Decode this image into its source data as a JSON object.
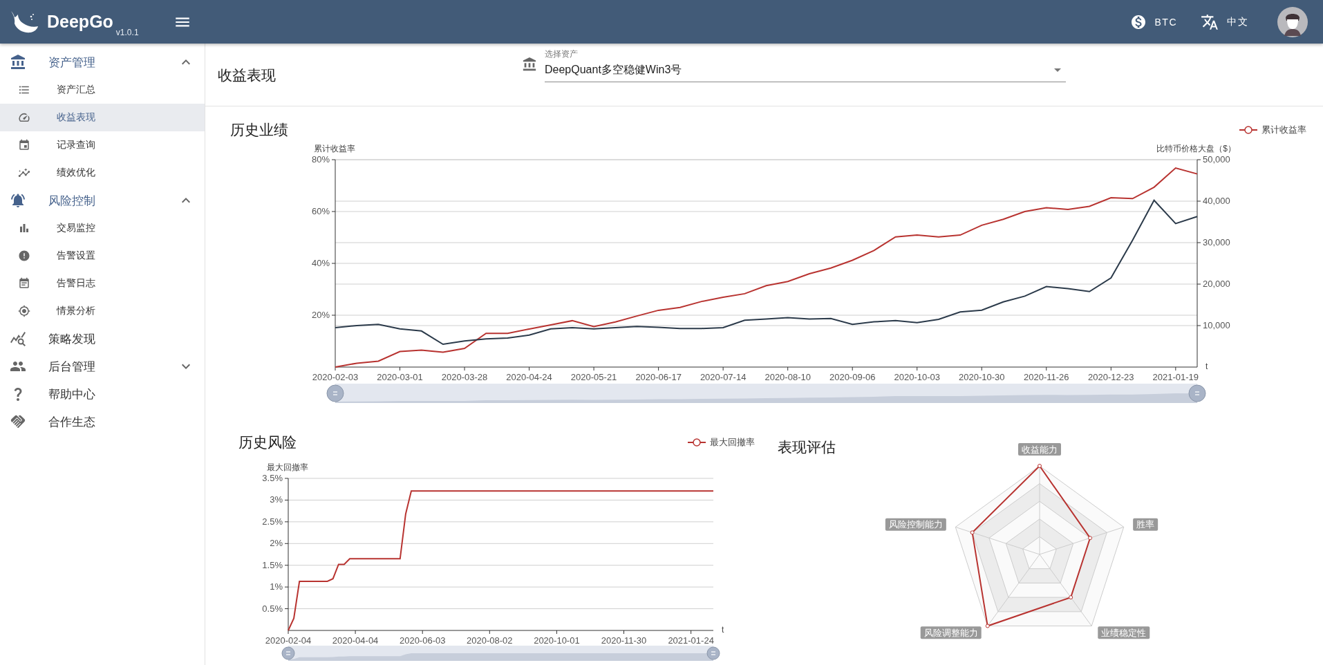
{
  "header": {
    "logo": "DeepGo",
    "version": "v1.0.1",
    "currency": "BTC",
    "language": "中文"
  },
  "sidebar": {
    "items": [
      {
        "label": "资产管理",
        "expanded": true,
        "children": [
          {
            "label": "资产汇总",
            "selected": false
          },
          {
            "label": "收益表现",
            "selected": true
          },
          {
            "label": "记录查询",
            "selected": false
          },
          {
            "label": "绩效优化",
            "selected": false
          }
        ]
      },
      {
        "label": "风险控制",
        "expanded": true,
        "children": [
          {
            "label": "交易监控",
            "selected": false
          },
          {
            "label": "告警设置",
            "selected": false
          },
          {
            "label": "告警日志",
            "selected": false
          },
          {
            "label": "情景分析",
            "selected": false
          }
        ]
      },
      {
        "label": "策略发现"
      },
      {
        "label": "后台管理",
        "expanded": false
      },
      {
        "label": "帮助中心"
      },
      {
        "label": "合作生态"
      }
    ]
  },
  "page": {
    "title": "收益表现",
    "asset_select": {
      "label": "选择资产",
      "value": "DeepQuant多空稳健Win3号"
    }
  },
  "history": {
    "title": "历史业绩",
    "chart_data": {
      "type": "line",
      "grid": true,
      "ylabel": "累计收益率",
      "y2label": "比特币价格大盘（$）",
      "xlabel": "t",
      "ylim": [
        0,
        80
      ],
      "y2lim": [
        0,
        50000
      ],
      "categories": [
        "2020-02-03",
        null,
        null,
        "2020-03-01",
        null,
        null,
        "2020-03-28",
        null,
        null,
        "2020-04-24",
        null,
        null,
        "2020-05-21",
        null,
        null,
        "2020-06-17",
        null,
        null,
        "2020-07-14",
        null,
        null,
        "2020-08-10",
        null,
        null,
        "2020-09-06",
        null,
        null,
        "2020-10-03",
        null,
        null,
        "2020-10-30",
        null,
        null,
        "2020-11-26",
        null,
        null,
        "2020-12-23",
        null,
        null,
        "2021-01-19",
        null
      ],
      "yticks": [
        {
          "value": 20,
          "label": "20%"
        },
        {
          "value": 40,
          "label": "40%"
        },
        {
          "value": 60,
          "label": "60%"
        },
        {
          "value": 80,
          "label": "80%"
        }
      ],
      "y2ticks": [
        {
          "value": 10000,
          "label": "10,000"
        },
        {
          "value": 20000,
          "label": "20,000"
        },
        {
          "value": 30000,
          "label": "30,000"
        },
        {
          "value": 40000,
          "label": "40,000"
        },
        {
          "value": 50000,
          "label": "50,000"
        }
      ],
      "series": [
        {
          "name": "累计收益率",
          "color": "#b83330",
          "values": [
            0,
            1.5,
            2.3,
            6,
            6.5,
            5.7,
            7.2,
            13,
            13,
            14.7,
            16.3,
            17.9,
            15.6,
            17.4,
            19.7,
            21.9,
            23,
            25.3,
            26.9,
            28.3,
            31.4,
            33,
            36,
            38.2,
            41.2,
            45,
            50.2,
            50.9,
            50.2,
            50.9,
            54.7,
            57,
            60,
            61.5,
            60.8,
            62,
            65.3,
            65,
            69.4,
            76.8,
            74.5
          ]
        },
        {
          "color": "#2b3a4a",
          "axis": "y2",
          "values": [
            9500,
            10000,
            10300,
            9200,
            8700,
            5500,
            6300,
            6800,
            7000,
            7700,
            9200,
            9500,
            9200,
            9500,
            9800,
            9600,
            9300,
            9300,
            9500,
            11300,
            11600,
            11900,
            11600,
            11700,
            10300,
            10900,
            11200,
            10700,
            11500,
            13300,
            13700,
            15700,
            17100,
            19400,
            18900,
            18200,
            21500,
            30600,
            40200,
            34600,
            36300
          ]
        }
      ]
    }
  },
  "risk": {
    "title": "历史风险",
    "chart_data": {
      "type": "line",
      "grid": true,
      "ylabel": "最大回撤率",
      "xlabel": "t",
      "ylim": [
        0,
        3.5
      ],
      "categories": [
        "2020-02-04",
        null,
        null,
        null,
        null,
        null,
        null,
        null,
        null,
        null,
        null,
        null,
        "2020-04-04",
        null,
        null,
        null,
        null,
        null,
        null,
        null,
        null,
        null,
        null,
        null,
        "2020-06-03",
        null,
        null,
        null,
        null,
        null,
        null,
        null,
        null,
        null,
        null,
        null,
        "2020-08-02",
        null,
        null,
        null,
        null,
        null,
        null,
        null,
        null,
        null,
        null,
        null,
        "2020-10-01",
        null,
        null,
        null,
        null,
        null,
        null,
        null,
        null,
        null,
        null,
        null,
        "2020-11-30",
        null,
        null,
        null,
        null,
        null,
        null,
        null,
        null,
        null,
        null,
        null,
        "2021-01-24",
        null,
        null,
        null,
        null
      ],
      "yticks": [
        {
          "value": 0.5,
          "label": "0.5%"
        },
        {
          "value": 1,
          "label": "1%"
        },
        {
          "value": 1.5,
          "label": "1.5%"
        },
        {
          "value": 2,
          "label": "2%"
        },
        {
          "value": 2.5,
          "label": "2.5%"
        },
        {
          "value": 3,
          "label": "3%"
        },
        {
          "value": 3.5,
          "label": "3.5%"
        }
      ],
      "series": [
        {
          "name": "最大回撤率",
          "color": "#b83330",
          "values": [
            0,
            0.28,
            1.13,
            1.13,
            1.13,
            1.13,
            1.13,
            1.13,
            1.19,
            1.52,
            1.52,
            1.65,
            1.65,
            1.65,
            1.65,
            1.65,
            1.65,
            1.65,
            1.65,
            1.65,
            1.65,
            2.68,
            3.21,
            3.21,
            3.21,
            3.21,
            3.21,
            3.21,
            3.21,
            3.21,
            3.21,
            3.21,
            3.21,
            3.21,
            3.21,
            3.21,
            3.21,
            3.21,
            3.21,
            3.21,
            3.21,
            3.21,
            3.21,
            3.21,
            3.21,
            3.21,
            3.21,
            3.21,
            3.21,
            3.21,
            3.21,
            3.21,
            3.21,
            3.21,
            3.21,
            3.21,
            3.21,
            3.21,
            3.21,
            3.21,
            3.21,
            3.21,
            3.21,
            3.21,
            3.21,
            3.21,
            3.21,
            3.21,
            3.21,
            3.21,
            3.21,
            3.21,
            3.21,
            3.21,
            3.21,
            3.21,
            3.21
          ]
        }
      ]
    }
  },
  "evaluation": {
    "title": "表现评估",
    "indicators": [
      "收益能力",
      "胜率",
      "业绩稳定性",
      "风险调整能力",
      "风险控制能力"
    ]
  }
}
